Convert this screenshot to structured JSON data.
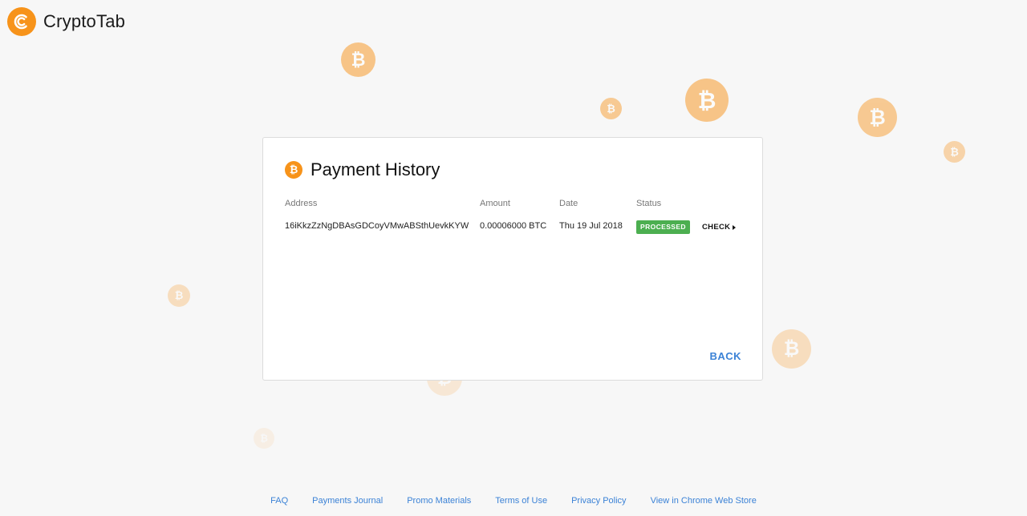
{
  "app": {
    "name": "CryptoTab",
    "brand_color": "#f7931a",
    "logo_icon": "cryptotab-logo-icon"
  },
  "coin_icon": "bitcoin-icon",
  "coin_symbol": "₿",
  "card": {
    "title": "Payment History",
    "columns": {
      "address": "Address",
      "amount": "Amount",
      "date": "Date",
      "status": "Status"
    },
    "rows": [
      {
        "address": "16iKkzZzNgDBAsGDCoyVMwABSthUevkKYW",
        "amount": "0.00006000 BTC",
        "date": "Thu 19 Jul 2018",
        "status": "PROCESSED",
        "status_color": "#4caf50",
        "action": "CHECK"
      }
    ],
    "back_label": "BACK",
    "link_color": "#3b82d6"
  },
  "footer": {
    "links": [
      "FAQ",
      "Payments Journal",
      "Promo Materials",
      "Terms of Use",
      "Privacy Policy",
      "View in Chrome Web Store"
    ]
  }
}
